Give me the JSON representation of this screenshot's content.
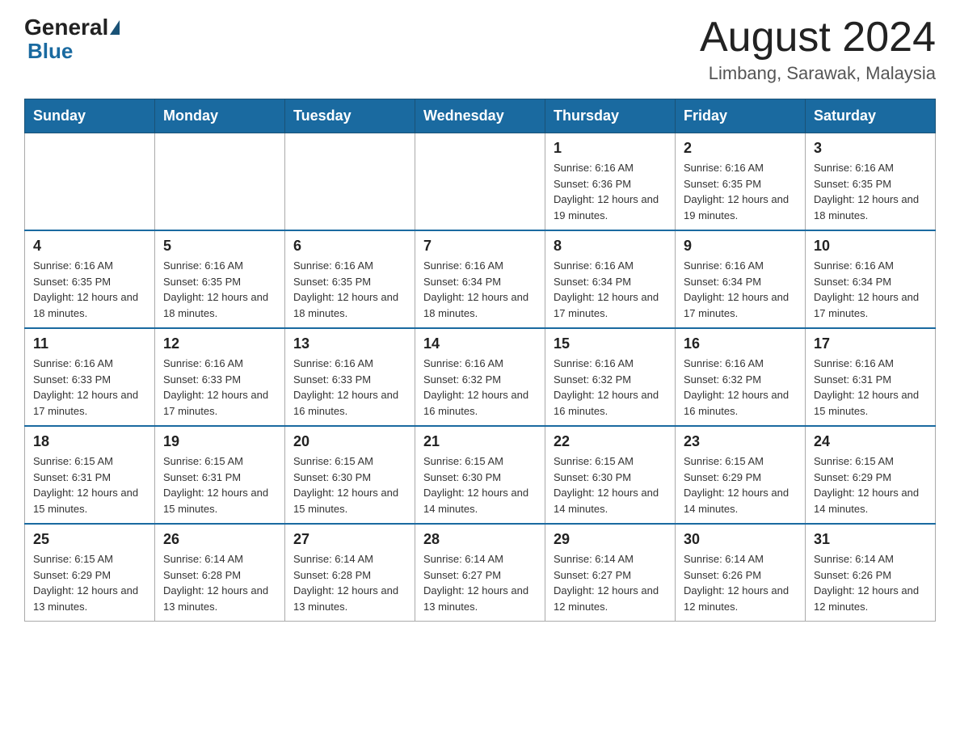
{
  "header": {
    "logo_general": "General",
    "logo_blue": "Blue",
    "month_title": "August 2024",
    "location": "Limbang, Sarawak, Malaysia"
  },
  "days_of_week": [
    "Sunday",
    "Monday",
    "Tuesday",
    "Wednesday",
    "Thursday",
    "Friday",
    "Saturday"
  ],
  "weeks": [
    [
      {
        "day": "",
        "info": ""
      },
      {
        "day": "",
        "info": ""
      },
      {
        "day": "",
        "info": ""
      },
      {
        "day": "",
        "info": ""
      },
      {
        "day": "1",
        "info": "Sunrise: 6:16 AM\nSunset: 6:36 PM\nDaylight: 12 hours and 19 minutes."
      },
      {
        "day": "2",
        "info": "Sunrise: 6:16 AM\nSunset: 6:35 PM\nDaylight: 12 hours and 19 minutes."
      },
      {
        "day": "3",
        "info": "Sunrise: 6:16 AM\nSunset: 6:35 PM\nDaylight: 12 hours and 18 minutes."
      }
    ],
    [
      {
        "day": "4",
        "info": "Sunrise: 6:16 AM\nSunset: 6:35 PM\nDaylight: 12 hours and 18 minutes."
      },
      {
        "day": "5",
        "info": "Sunrise: 6:16 AM\nSunset: 6:35 PM\nDaylight: 12 hours and 18 minutes."
      },
      {
        "day": "6",
        "info": "Sunrise: 6:16 AM\nSunset: 6:35 PM\nDaylight: 12 hours and 18 minutes."
      },
      {
        "day": "7",
        "info": "Sunrise: 6:16 AM\nSunset: 6:34 PM\nDaylight: 12 hours and 18 minutes."
      },
      {
        "day": "8",
        "info": "Sunrise: 6:16 AM\nSunset: 6:34 PM\nDaylight: 12 hours and 17 minutes."
      },
      {
        "day": "9",
        "info": "Sunrise: 6:16 AM\nSunset: 6:34 PM\nDaylight: 12 hours and 17 minutes."
      },
      {
        "day": "10",
        "info": "Sunrise: 6:16 AM\nSunset: 6:34 PM\nDaylight: 12 hours and 17 minutes."
      }
    ],
    [
      {
        "day": "11",
        "info": "Sunrise: 6:16 AM\nSunset: 6:33 PM\nDaylight: 12 hours and 17 minutes."
      },
      {
        "day": "12",
        "info": "Sunrise: 6:16 AM\nSunset: 6:33 PM\nDaylight: 12 hours and 17 minutes."
      },
      {
        "day": "13",
        "info": "Sunrise: 6:16 AM\nSunset: 6:33 PM\nDaylight: 12 hours and 16 minutes."
      },
      {
        "day": "14",
        "info": "Sunrise: 6:16 AM\nSunset: 6:32 PM\nDaylight: 12 hours and 16 minutes."
      },
      {
        "day": "15",
        "info": "Sunrise: 6:16 AM\nSunset: 6:32 PM\nDaylight: 12 hours and 16 minutes."
      },
      {
        "day": "16",
        "info": "Sunrise: 6:16 AM\nSunset: 6:32 PM\nDaylight: 12 hours and 16 minutes."
      },
      {
        "day": "17",
        "info": "Sunrise: 6:16 AM\nSunset: 6:31 PM\nDaylight: 12 hours and 15 minutes."
      }
    ],
    [
      {
        "day": "18",
        "info": "Sunrise: 6:15 AM\nSunset: 6:31 PM\nDaylight: 12 hours and 15 minutes."
      },
      {
        "day": "19",
        "info": "Sunrise: 6:15 AM\nSunset: 6:31 PM\nDaylight: 12 hours and 15 minutes."
      },
      {
        "day": "20",
        "info": "Sunrise: 6:15 AM\nSunset: 6:30 PM\nDaylight: 12 hours and 15 minutes."
      },
      {
        "day": "21",
        "info": "Sunrise: 6:15 AM\nSunset: 6:30 PM\nDaylight: 12 hours and 14 minutes."
      },
      {
        "day": "22",
        "info": "Sunrise: 6:15 AM\nSunset: 6:30 PM\nDaylight: 12 hours and 14 minutes."
      },
      {
        "day": "23",
        "info": "Sunrise: 6:15 AM\nSunset: 6:29 PM\nDaylight: 12 hours and 14 minutes."
      },
      {
        "day": "24",
        "info": "Sunrise: 6:15 AM\nSunset: 6:29 PM\nDaylight: 12 hours and 14 minutes."
      }
    ],
    [
      {
        "day": "25",
        "info": "Sunrise: 6:15 AM\nSunset: 6:29 PM\nDaylight: 12 hours and 13 minutes."
      },
      {
        "day": "26",
        "info": "Sunrise: 6:14 AM\nSunset: 6:28 PM\nDaylight: 12 hours and 13 minutes."
      },
      {
        "day": "27",
        "info": "Sunrise: 6:14 AM\nSunset: 6:28 PM\nDaylight: 12 hours and 13 minutes."
      },
      {
        "day": "28",
        "info": "Sunrise: 6:14 AM\nSunset: 6:27 PM\nDaylight: 12 hours and 13 minutes."
      },
      {
        "day": "29",
        "info": "Sunrise: 6:14 AM\nSunset: 6:27 PM\nDaylight: 12 hours and 12 minutes."
      },
      {
        "day": "30",
        "info": "Sunrise: 6:14 AM\nSunset: 6:26 PM\nDaylight: 12 hours and 12 minutes."
      },
      {
        "day": "31",
        "info": "Sunrise: 6:14 AM\nSunset: 6:26 PM\nDaylight: 12 hours and 12 minutes."
      }
    ]
  ]
}
